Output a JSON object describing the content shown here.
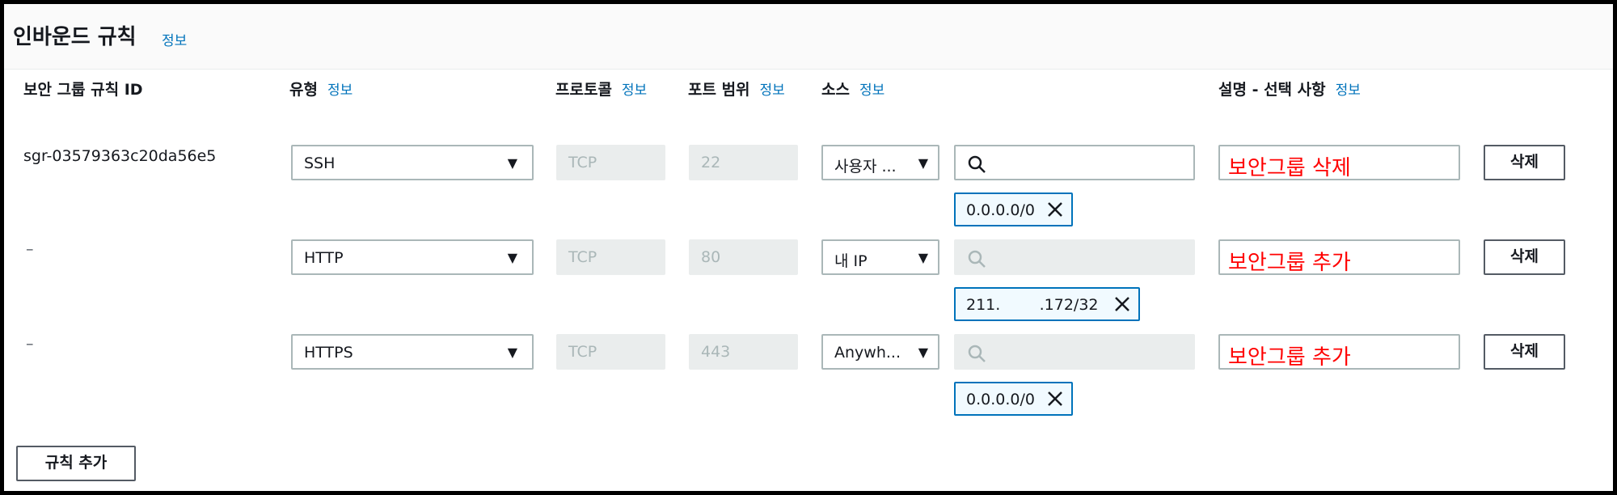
{
  "header": {
    "title": "인바운드 규칙",
    "info": "정보"
  },
  "columns": {
    "rule_id": "보안 그룹 규칙 ID",
    "type": "유형",
    "type_info": "정보",
    "protocol": "프로토콜",
    "protocol_info": "정보",
    "port_range": "포트 범위",
    "port_range_info": "정보",
    "source": "소스",
    "source_info": "정보",
    "description": "설명 - 선택 사항",
    "description_info": "정보"
  },
  "rules": [
    {
      "id": "sgr-03579363c20da56e5",
      "type": "SSH",
      "protocol": "TCP",
      "port": "22",
      "source_type": "사용자 ...",
      "search_disabled": false,
      "cidr": "0.0.0.0/0",
      "description": "보안그룹 삭제",
      "delete": "삭제"
    },
    {
      "id": "–",
      "type": "HTTP",
      "protocol": "TCP",
      "port": "80",
      "source_type": "내 IP",
      "search_disabled": true,
      "cidr": "211.        .172/32",
      "description": "보안그룹 추가",
      "delete": "삭제"
    },
    {
      "id": "–",
      "type": "HTTPS",
      "protocol": "TCP",
      "port": "443",
      "source_type": "Anywh...",
      "search_disabled": true,
      "cidr": "0.0.0.0/0",
      "description": "보안그룹 추가",
      "delete": "삭제"
    }
  ],
  "footer": {
    "add_rule": "규칙 추가"
  },
  "icons": {
    "caret": "caret-down-icon",
    "search": "search-icon",
    "remove": "close-icon"
  },
  "colors": {
    "info_link": "#0073bb",
    "description_text": "#ff0000",
    "token_border": "#0073bb",
    "disabled_bg": "#eaeded"
  }
}
